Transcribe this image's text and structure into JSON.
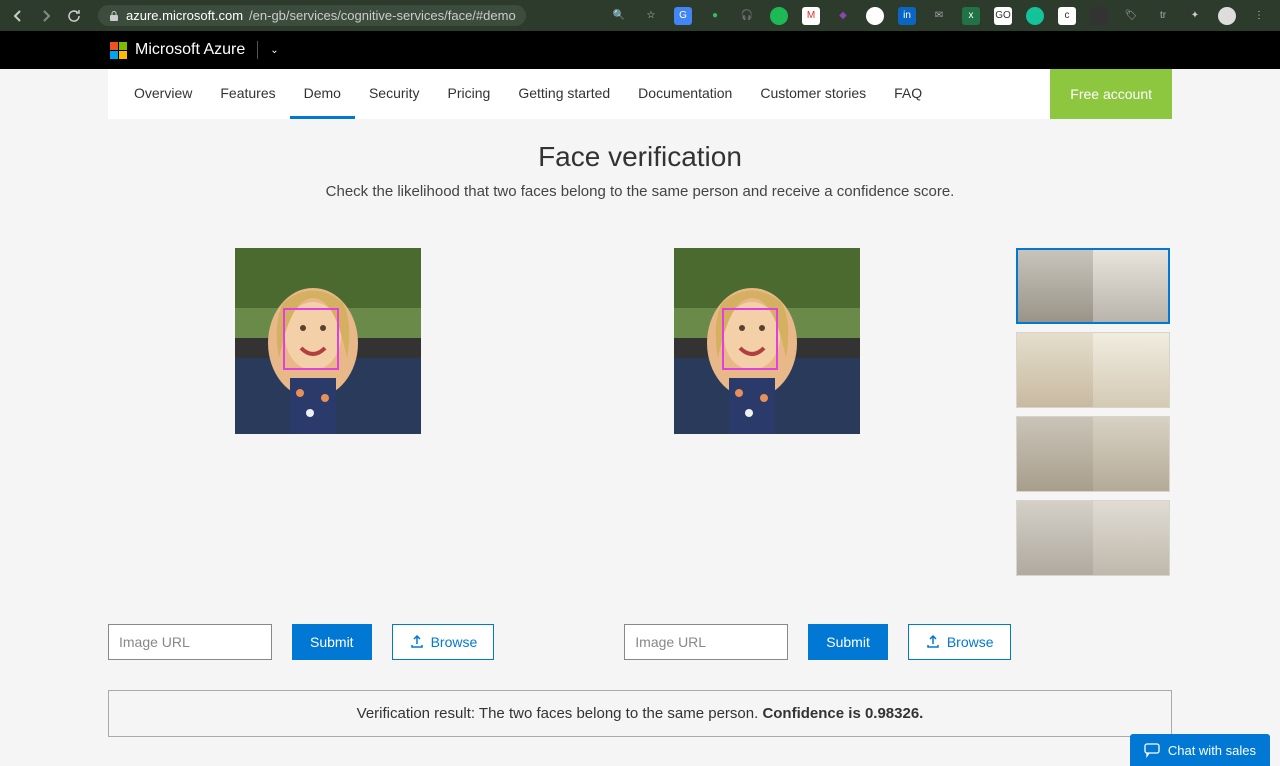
{
  "browser": {
    "url_prefix": "azure.microsoft.com",
    "url_path": "/en-gb/services/cognitive-services/face/#demo"
  },
  "header": {
    "brand": "Microsoft Azure"
  },
  "nav": {
    "tabs": [
      {
        "label": "Overview"
      },
      {
        "label": "Features"
      },
      {
        "label": "Demo",
        "active": true
      },
      {
        "label": "Security"
      },
      {
        "label": "Pricing"
      },
      {
        "label": "Getting started"
      },
      {
        "label": "Documentation"
      },
      {
        "label": "Customer stories"
      },
      {
        "label": "FAQ"
      }
    ],
    "free_account": "Free account"
  },
  "main": {
    "title": "Face verification",
    "subtitle": "Check the likelihood that two faces belong to the same person and receive a confidence score."
  },
  "controls": {
    "left": {
      "placeholder": "Image URL",
      "submit": "Submit",
      "browse": "Browse"
    },
    "right": {
      "placeholder": "Image URL",
      "submit": "Submit",
      "browse": "Browse"
    }
  },
  "result": {
    "text": "Verification result: The two faces belong to the same person. ",
    "confidence": "Confidence is 0.98326."
  },
  "chat": {
    "label": "Chat with sales"
  },
  "thumbs": {
    "selected_index": 0,
    "items": [
      {
        "name": "sample-pair-1"
      },
      {
        "name": "sample-pair-2"
      },
      {
        "name": "sample-pair-3"
      },
      {
        "name": "sample-pair-4"
      }
    ]
  }
}
